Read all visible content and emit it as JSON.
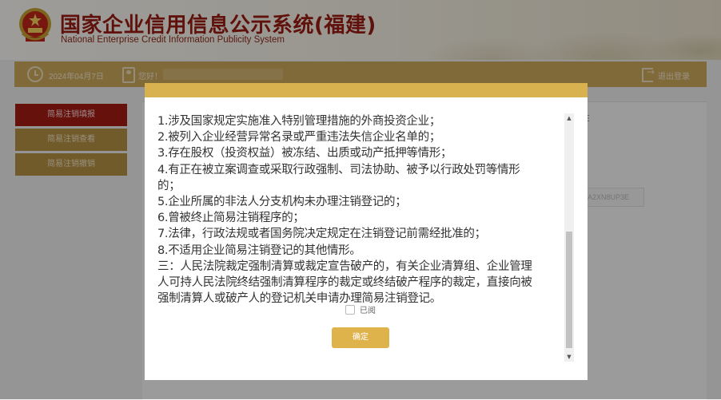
{
  "header": {
    "title_cn": "国家企业信用信息公示系统(福建)",
    "title_en": "National Enterprise Credit Information Publicity System"
  },
  "infobar": {
    "date": "2024年04月7日",
    "greeting": "您好！",
    "logout": "退出登录"
  },
  "sidebar": {
    "items": [
      {
        "label": "简易注销填报",
        "active": true
      },
      {
        "label": "简易注销查看",
        "active": false
      },
      {
        "label": "简易注销撤销",
        "active": false
      }
    ]
  },
  "background": {
    "code_fragment": "A2XN8UP3E",
    "heading_fragment": "E"
  },
  "modal": {
    "lines": [
      "1.涉及国家规定实施准入特别管理措施的外商投资企业；",
      "2.被列入企业经营异常名录或严重违法失信企业名单的；",
      "3.存在股权（投资权益）被冻结、出质或动产抵押等情形；",
      "4.有正在被立案调查或采取行政强制、司法协助、被予以行政处罚等情形",
      "的；",
      "5.企业所属的非法人分支机构未办理注销登记的；",
      "6.曾被终止简易注销程序的；",
      "7.法律，行政法规或者国务院决定规定在注销登记前需经批准的；",
      "8.不适用企业简易注销登记的其他情形。",
      "三：人民法院裁定强制清算或裁定宣告破产的，有关企业清算组、企业管理",
      "人可持人民法院终结强制清算程序的裁定或终结破产程序的裁定，直接向被",
      "强制清算人或破产人的登记机关申请办理简易注销登记。"
    ],
    "read_label": "已阅",
    "read_checked": false,
    "confirm_label": "确定"
  },
  "colors": {
    "accent_gold": "#d8b24f",
    "sidebar_active": "#a71c16",
    "sidebar_normal": "#b99444",
    "title_red": "#9b1c12"
  }
}
